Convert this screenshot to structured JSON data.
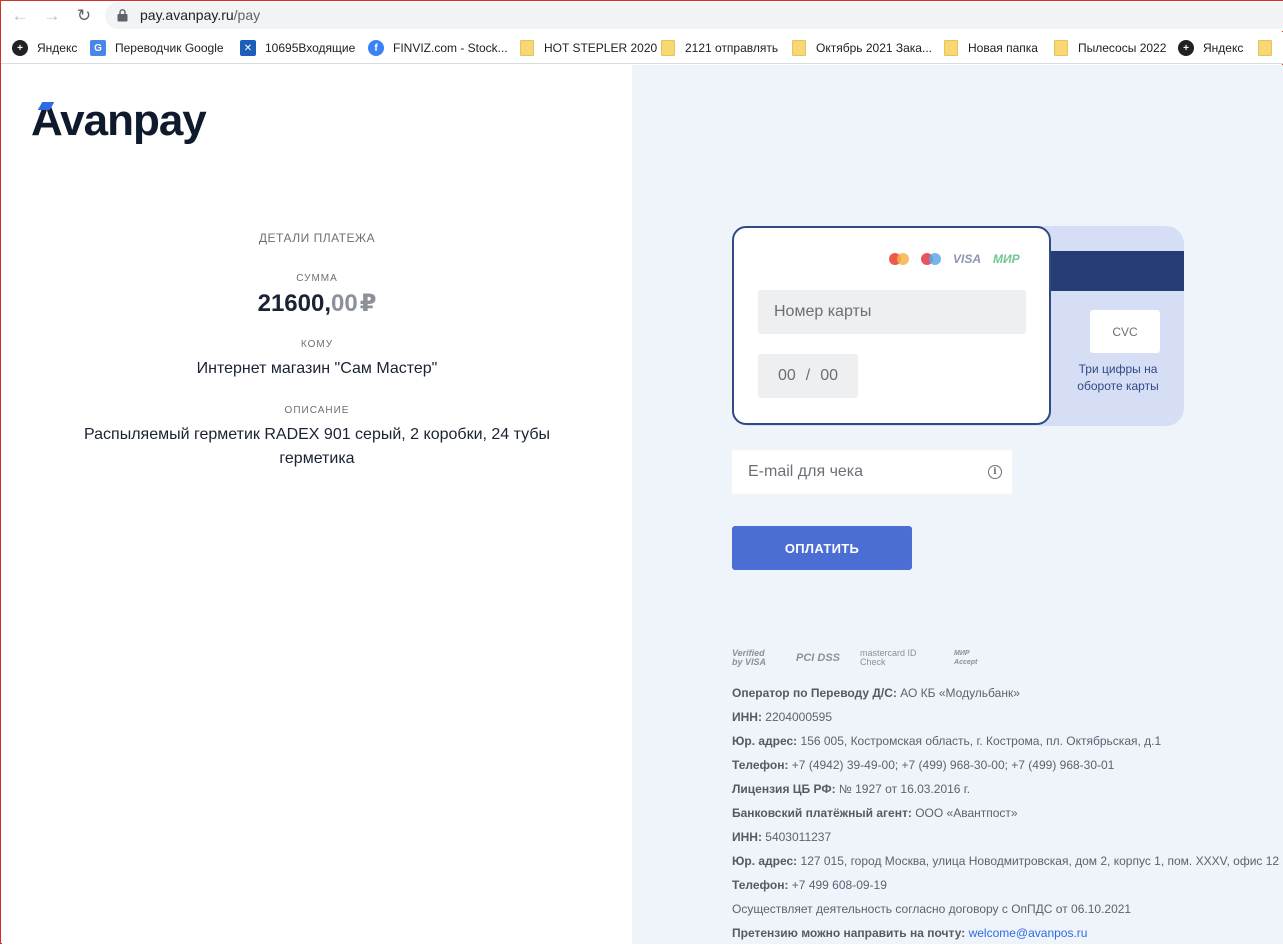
{
  "browser": {
    "url_domain": "pay.avanpay.ru",
    "url_path": "/pay",
    "bookmarks": [
      {
        "label": "Яндекс",
        "icon": "yandex-icon"
      },
      {
        "label": "Переводчик Google",
        "icon": "google-translate-icon"
      },
      {
        "label": "10695Входящие",
        "icon": "mail-icon"
      },
      {
        "label": "FINVIZ.com - Stock...",
        "icon": "finviz-icon"
      },
      {
        "label": "HOT STEPLER 2020",
        "icon": "folder-icon"
      },
      {
        "label": "2121 отправлять",
        "icon": "folder-icon"
      },
      {
        "label": "Октябрь 2021 Зака...",
        "icon": "folder-icon"
      },
      {
        "label": "Новая папка",
        "icon": "folder-icon"
      },
      {
        "label": "Пылесосы 2022",
        "icon": "folder-icon"
      },
      {
        "label": "Яндекс",
        "icon": "yandex-icon"
      }
    ]
  },
  "brand": {
    "name": "Avanpay"
  },
  "payment": {
    "section_title": "ДЕТАЛИ ПЛАТЕЖА",
    "amount_label": "СУММА",
    "amount_whole": "21600,",
    "amount_cents": "00",
    "currency": "₽",
    "recipient_label": "КОМУ",
    "recipient": "Интернет магазин \"Сам Мастер\"",
    "description_label": "ОПИСАНИЕ",
    "description_line1": "Распыляемый герметик RADEX 901 серый, 2 коробки, 24 тубы",
    "description_line2": "герметика"
  },
  "card": {
    "brands": [
      "mastercard",
      "maestro",
      "VISA",
      "МИР"
    ],
    "visa_label": "VISA",
    "mir_label": "МИР",
    "number_placeholder": "Номер карты",
    "expiry_month": "00",
    "expiry_separator": "/",
    "expiry_year": "00",
    "cvc_label": "CVC",
    "cvc_hint": "Три цифры на обороте карты"
  },
  "email": {
    "placeholder": "E-mail для чека"
  },
  "pay_button": "ОПЛАТИТЬ",
  "security_badges": [
    {
      "label": "Verified by VISA"
    },
    {
      "label": "PCI DSS"
    },
    {
      "label": "mastercard ID Check"
    },
    {
      "label": "МИР Accept"
    }
  ],
  "legal": [
    {
      "key": "Оператор по Переводу Д/С:",
      "value": " АО КБ «Модульбанк»"
    },
    {
      "key": "ИНН:",
      "value": " 2204000595"
    },
    {
      "key": "Юр. адрес:",
      "value": " 156 005, Костромская область, г. Кострома, пл. Октябрьская, д.1"
    },
    {
      "key": "Телефон:",
      "value": " +7 (4942) 39-49-00; +7 (499) 968-30-00; +7 (499) 968-30-01"
    },
    {
      "key": "Лицензия ЦБ РФ:",
      "value": " № 1927 от 16.03.2016 г."
    },
    {
      "key": "Банковский платёжный агент:",
      "value": " ООО «Авантпост»"
    },
    {
      "key": "ИНН:",
      "value": " 5403011237"
    },
    {
      "key": "Юр. адрес:",
      "value": " 127 015, город Москва, улица Новодмитровская, дом 2, корпус 1, пом. XXXV, офис 12"
    },
    {
      "key": "Телефон:",
      "value": " +7 499 608-09-19"
    },
    {
      "key": "",
      "value": "Осуществляет деятельность согласно договору с ОпПДС от 06.10.2021"
    }
  ],
  "claim": {
    "label": "Претензию можно направить на почту:",
    "email": "welcome@avanpos.ru"
  },
  "colors": {
    "accent": "#4a6ed3",
    "card_border": "#2f4a85",
    "right_panel": "#eff3fa"
  }
}
